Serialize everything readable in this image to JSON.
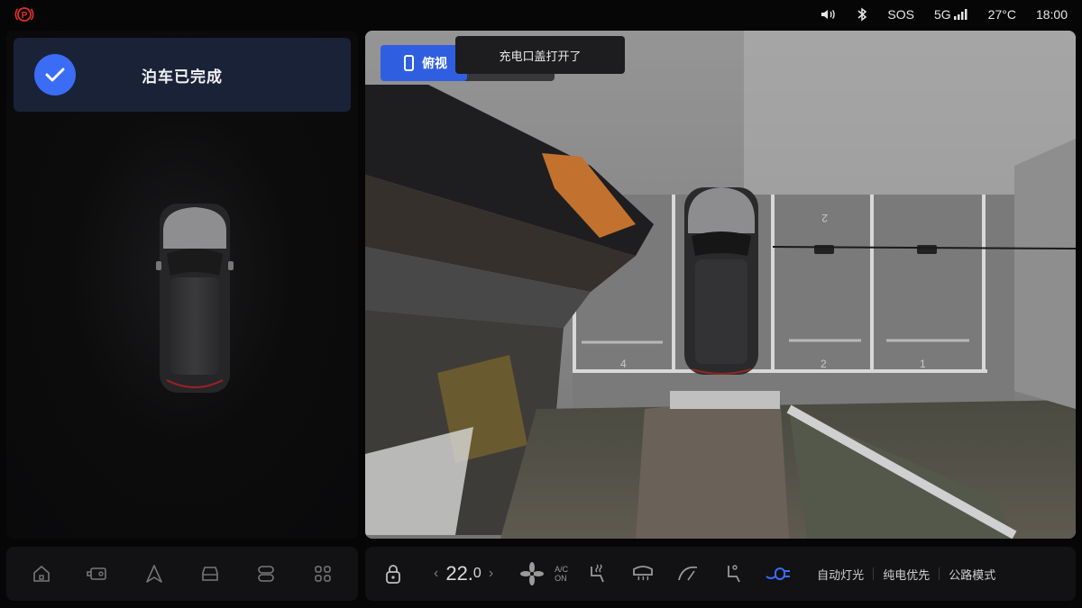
{
  "status_bar": {
    "sos": "SOS",
    "network": "5G",
    "temperature": "27°C",
    "time": "18:00"
  },
  "parking": {
    "status_text": "泊车已完成"
  },
  "camera": {
    "view_label": "俯视",
    "toast": "充电口盖打开了",
    "slot_numbers": [
      "4",
      "2",
      "1",
      "2"
    ]
  },
  "climate": {
    "temp_int": "22.",
    "temp_dec": "0",
    "ac_line1": "A/C",
    "ac_line2": "ON",
    "left_arrow": "‹",
    "right_arrow": "›"
  },
  "modes": {
    "auto_light": "自动灯光",
    "ev_priority": "纯电优先",
    "road_mode": "公路模式"
  },
  "colors": {
    "accent": "#3b6cf6",
    "card_bg": "#1a2238",
    "active_icon": "#3b6cf6"
  },
  "icons": {
    "dock_left": [
      "home-icon",
      "camera-icon",
      "navigation-icon",
      "car-icon",
      "toggle-icon",
      "apps-icon"
    ],
    "dock_right": [
      "lock-icon",
      "fan-icon",
      "seat-heat-icon",
      "defrost-icon",
      "wiper-icon",
      "seat-icon",
      "charge-port-icon"
    ]
  }
}
